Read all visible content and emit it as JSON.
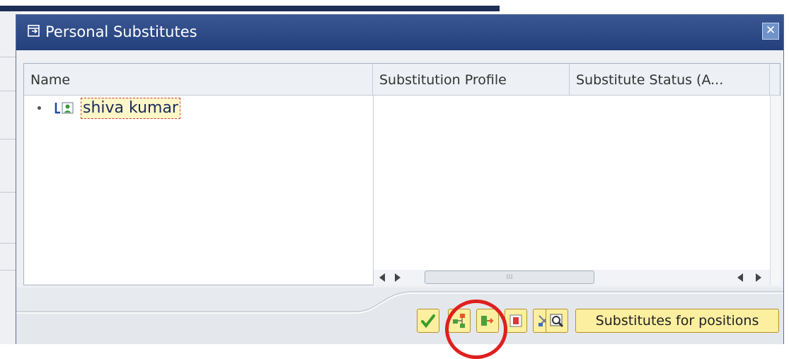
{
  "dialog": {
    "title": "Personal Substitutes",
    "close_label": "✕"
  },
  "table": {
    "columns": [
      {
        "label": "Name"
      },
      {
        "label": "Substitution Profile"
      },
      {
        "label": "Substitute Status (A..."
      }
    ],
    "rows": [
      {
        "name": "shiva kumar",
        "icon": "user-node-icon"
      }
    ],
    "scroll_grip": "⁞⁞⁞"
  },
  "toolbar": {
    "buttons": [
      {
        "icon": "check-icon"
      },
      {
        "icon": "org-structure-icon"
      },
      {
        "icon": "substitute-assign-icon"
      },
      {
        "icon": "delete-substitute-icon"
      },
      {
        "icon": "cut-icon"
      },
      {
        "icon": "find-icon"
      }
    ],
    "substitutes_for_positions_label": "Substitutes for positions"
  },
  "colors": {
    "titlebar": "#2f4b88",
    "button_fill": "#fcefa0",
    "highlight": "#e01f1f"
  }
}
